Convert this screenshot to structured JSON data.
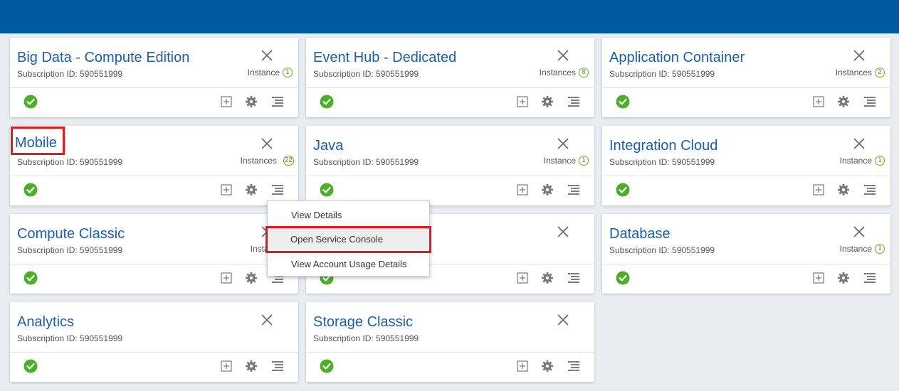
{
  "header": {
    "color": "#005aa3"
  },
  "colors": {
    "title": "#1d5fa8",
    "ok": "#4caf28",
    "highlight": "#e2181c"
  },
  "cards": [
    {
      "title": "Big Data - Compute Edition",
      "subscription": "Subscription ID: 590551999",
      "instances_label": "Instance",
      "instances_count": "1",
      "status": "ok"
    },
    {
      "title": "Event Hub - Dedicated",
      "subscription": "Subscription ID: 590551999",
      "instances_label": "Instances",
      "instances_count": "8",
      "status": "ok"
    },
    {
      "title": "Application Container",
      "subscription": "Subscription ID: 590551999",
      "instances_label": "Instances",
      "instances_count": "2",
      "status": "ok"
    },
    {
      "title": "Mobile",
      "subscription": "Subscription ID: 590551999",
      "instances_label": "Instances",
      "instances_count": "22",
      "status": "ok",
      "highlighted": true
    },
    {
      "title": "Java",
      "subscription": "Subscription ID: 590551999",
      "instances_label": "Instance",
      "instances_count": "1",
      "status": "ok"
    },
    {
      "title": "Integration Cloud",
      "subscription": "Subscription ID: 590551999",
      "instances_label": "Instance",
      "instances_count": "1",
      "status": "ok"
    },
    {
      "title": "Compute Classic",
      "subscription": "Subscription ID: 590551999",
      "instances_label": "Instances",
      "instances_count": "",
      "status": "ok"
    },
    {
      "title": "",
      "subscription": "",
      "instances_label": "",
      "instances_count": "",
      "status": "ok"
    },
    {
      "title": "Database",
      "subscription": "Subscription ID: 590551999",
      "instances_label": "Instance",
      "instances_count": "1",
      "status": "ok"
    },
    {
      "title": "Analytics",
      "subscription": "Subscription ID: 590551999",
      "instances_label": "",
      "instances_count": "",
      "status": "ok"
    },
    {
      "title": "Storage Classic",
      "subscription": "Subscription ID: 590551999",
      "instances_label": "",
      "instances_count": "",
      "status": "ok"
    }
  ],
  "context_menu": {
    "items": [
      {
        "label": "View Details"
      },
      {
        "label": "Open Service Console",
        "highlighted": true
      },
      {
        "label": "View Account Usage Details"
      }
    ]
  },
  "icons": {
    "close": "close-icon",
    "status": "check-circle-icon",
    "add": "add-box-icon",
    "settings": "gear-icon",
    "menu": "menu-lines-icon"
  }
}
